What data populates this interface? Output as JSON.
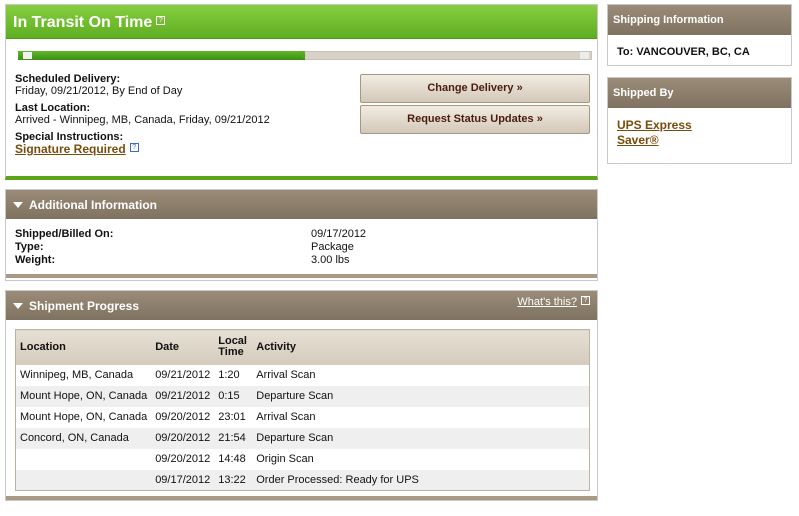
{
  "status": {
    "title": "In Transit On Time",
    "help_glyph": "?",
    "progress": 0.5,
    "scheduled_label": "Scheduled Delivery:",
    "scheduled_value": "Friday, 09/21/2012, By End of Day",
    "last_location_label": "Last Location:",
    "last_location_value": "Arrived - Winnipeg, MB, Canada, Friday, 09/21/2012",
    "special_label": "Special Instructions:",
    "special_value": "Signature Required",
    "buttons": {
      "change": "Change Delivery »",
      "request": "Request Status Updates »"
    }
  },
  "additional": {
    "title": "Additional Information",
    "rows": [
      {
        "label": "Shipped/Billed On:",
        "value": "09/17/2012"
      },
      {
        "label": "Type:",
        "value": "Package"
      },
      {
        "label": "Weight:",
        "value": "3.00 lbs"
      }
    ]
  },
  "shipment_progress": {
    "title": "Shipment Progress",
    "whats_this": "What's this?",
    "columns": [
      "Location",
      "Date",
      "Local Time",
      "Activity"
    ],
    "rows": [
      {
        "location": "Winnipeg, MB, Canada",
        "date": "09/21/2012",
        "time": "1:20",
        "activity": "Arrival Scan"
      },
      {
        "location": "Mount Hope, ON, Canada",
        "date": "09/21/2012",
        "time": "0:15",
        "activity": "Departure Scan"
      },
      {
        "location": "Mount Hope, ON, Canada",
        "date": "09/20/2012",
        "time": "23:01",
        "activity": "Arrival Scan"
      },
      {
        "location": "Concord, ON, Canada",
        "date": "09/20/2012",
        "time": "21:54",
        "activity": "Departure Scan"
      },
      {
        "location": "",
        "date": "09/20/2012",
        "time": "14:48",
        "activity": "Origin Scan"
      },
      {
        "location": "",
        "date": "09/17/2012",
        "time": "13:22",
        "activity": "Order Processed: Ready for UPS"
      }
    ]
  },
  "sidebar": {
    "shipping_info_title": "Shipping Information",
    "to_value": "To:  VANCOUVER, BC, CA",
    "shipped_by_title": "Shipped By",
    "service": "UPS Express Saver®"
  },
  "colors": {
    "status_green": "#5fae22",
    "section_brown": "#8a7d6a",
    "link_brown": "#7a4c0c"
  }
}
